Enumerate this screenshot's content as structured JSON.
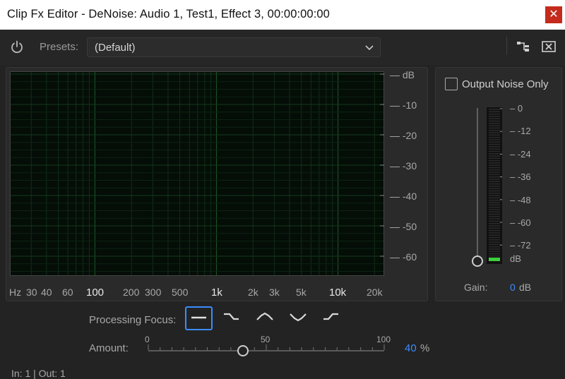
{
  "window": {
    "title": "Clip Fx Editor - DeNoise: Audio 1, Test1, Effect 3, 00:00:00:00",
    "close_glyph": "✕"
  },
  "toolbar": {
    "presets_label": "Presets:",
    "preset_value": "(Default)"
  },
  "graph": {
    "y_unit": "dB",
    "y_ticks": [
      "-10",
      "-20",
      "-30",
      "-40",
      "-50",
      "-60"
    ],
    "x_unit": "Hz",
    "x_ticks": [
      "30",
      "40",
      "60",
      "100",
      "200",
      "300",
      "500",
      "1k",
      "2k",
      "3k",
      "5k",
      "10k",
      "20k"
    ]
  },
  "output": {
    "checkbox_label": "Output Noise Only",
    "checked": false,
    "meter_labels": [
      "0",
      "-12",
      "-24",
      "-36",
      "-48",
      "-60",
      "-72",
      "dB"
    ],
    "gain_label": "Gain:",
    "gain_value": "0",
    "gain_unit": "dB"
  },
  "processing_focus": {
    "label": "Processing Focus:",
    "options": [
      "flat",
      "low",
      "mid",
      "notch",
      "high"
    ],
    "selected": "flat",
    "accent": "#3b8cff"
  },
  "amount": {
    "label": "Amount:",
    "tick_labels": [
      "0",
      "50",
      "100"
    ],
    "value": "40",
    "unit": "%",
    "fraction": 0.4
  },
  "status": {
    "text": "In: 1 | Out: 1"
  }
}
